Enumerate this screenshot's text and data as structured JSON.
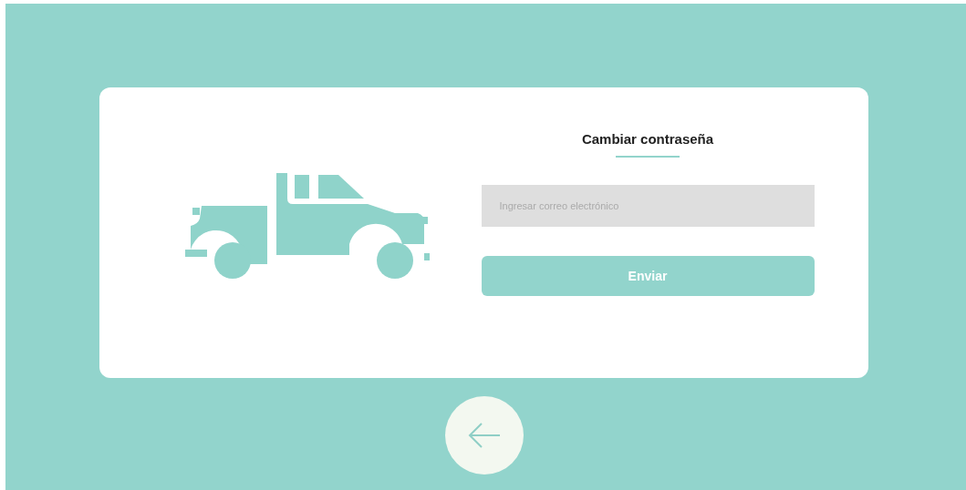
{
  "form": {
    "title": "Cambiar contraseña",
    "email_field": {
      "placeholder": "Ingresar correo electrónico"
    },
    "submit_button": "Enviar"
  }
}
